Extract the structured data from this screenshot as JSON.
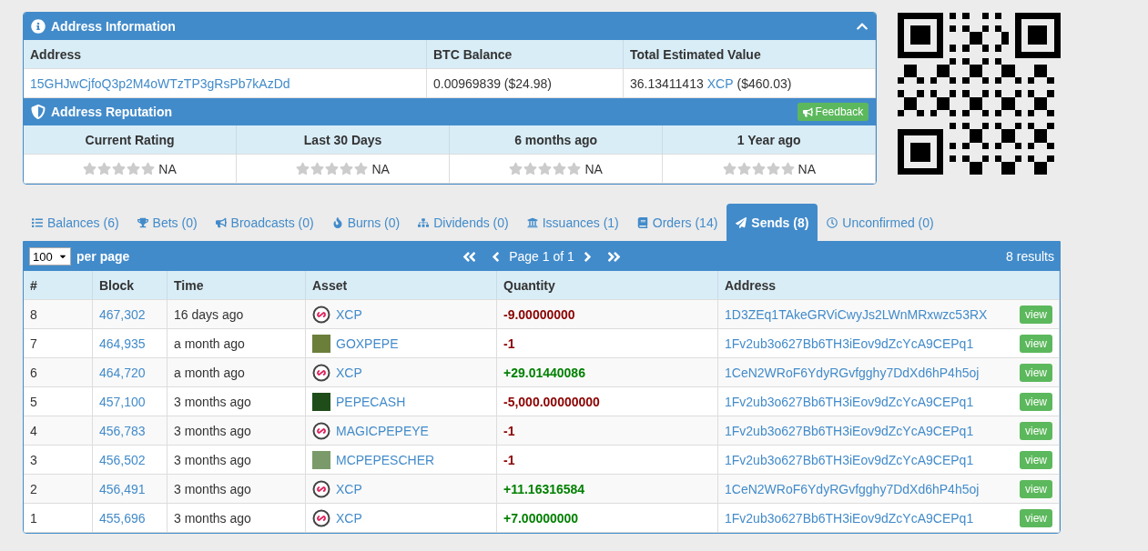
{
  "address_info": {
    "title": "Address Information",
    "collapsed": false,
    "columns": [
      "Address",
      "BTC Balance",
      "Total Estimated Value"
    ],
    "address": "15GHJwCjfoQ3p2M4oWTzTP3gRsPb7kAzDd",
    "btc_balance": "0.00969839 ($24.98)",
    "total_amount": "36.13411413",
    "total_asset": "XCP",
    "total_usd": "($460.03)"
  },
  "reputation": {
    "title": "Address Reputation",
    "feedback_button": "Feedback",
    "periods": [
      {
        "label": "Current Rating",
        "stars": 0,
        "value": "NA"
      },
      {
        "label": "Last 30 Days",
        "stars": 0,
        "value": "NA"
      },
      {
        "label": "6 months ago",
        "stars": 0,
        "value": "NA"
      },
      {
        "label": "1 Year ago",
        "stars": 0,
        "value": "NA"
      }
    ]
  },
  "tabs": [
    {
      "label": "Balances (6)",
      "selected": false
    },
    {
      "label": "Bets (0)",
      "selected": false
    },
    {
      "label": "Broadcasts (0)",
      "selected": false
    },
    {
      "label": "Burns (0)",
      "selected": false
    },
    {
      "label": "Dividends (0)",
      "selected": false
    },
    {
      "label": "Issuances (1)",
      "selected": false
    },
    {
      "label": "Orders (14)",
      "selected": false
    },
    {
      "label": "Sends (8)",
      "selected": true
    },
    {
      "label": "Unconfirmed (0)",
      "selected": false
    }
  ],
  "pager": {
    "per_page_value": "100",
    "per_page_label": "per page",
    "page_text": "Page 1 of 1",
    "results": "8 results"
  },
  "table": {
    "columns": [
      "#",
      "Block",
      "Time",
      "Asset",
      "Quantity",
      "Address"
    ],
    "rows": [
      {
        "index": "8",
        "block": "467,302",
        "time": "16 days ago",
        "asset": {
          "name": "XCP",
          "kind": "token"
        },
        "quantity": {
          "text": "-9.00000000",
          "kind": "out"
        },
        "address": "1D3ZEq1TAkeGRViCwyJs2LWnMRxwzc53RX",
        "view": "view"
      },
      {
        "index": "7",
        "block": "464,935",
        "time": "a month ago",
        "asset": {
          "name": "GOXPEPE",
          "kind": "image"
        },
        "quantity": {
          "text": "-1",
          "kind": "out"
        },
        "address": "1Fv2ub3o627Bb6TH3iEov9dZcYcA9CEPq1",
        "view": "view"
      },
      {
        "index": "6",
        "block": "464,720",
        "time": "a month ago",
        "asset": {
          "name": "XCP",
          "kind": "token"
        },
        "quantity": {
          "text": "+29.01440086",
          "kind": "in"
        },
        "address": "1CeN2WRoF6YdyRGvfgghy7DdXd6hP4h5oj",
        "view": "view"
      },
      {
        "index": "5",
        "block": "457,100",
        "time": "3 months ago",
        "asset": {
          "name": "PEPECASH",
          "kind": "image"
        },
        "quantity": {
          "text": "-5,000.00000000",
          "kind": "out"
        },
        "address": "1Fv2ub3o627Bb6TH3iEov9dZcYcA9CEPq1",
        "view": "view"
      },
      {
        "index": "4",
        "block": "456,783",
        "time": "3 months ago",
        "asset": {
          "name": "MAGICPEPEYE",
          "kind": "token"
        },
        "quantity": {
          "text": "-1",
          "kind": "out"
        },
        "address": "1Fv2ub3o627Bb6TH3iEov9dZcYcA9CEPq1",
        "view": "view"
      },
      {
        "index": "3",
        "block": "456,502",
        "time": "3 months ago",
        "asset": {
          "name": "MCPEPESCHER",
          "kind": "image"
        },
        "quantity": {
          "text": "-1",
          "kind": "out"
        },
        "address": "1Fv2ub3o627Bb6TH3iEov9dZcYcA9CEPq1",
        "view": "view"
      },
      {
        "index": "2",
        "block": "456,491",
        "time": "3 months ago",
        "asset": {
          "name": "XCP",
          "kind": "token"
        },
        "quantity": {
          "text": "+11.16316584",
          "kind": "in"
        },
        "address": "1CeN2WRoF6YdyRGvfgghy7DdXd6hP4h5oj",
        "view": "view"
      },
      {
        "index": "1",
        "block": "455,696",
        "time": "3 months ago",
        "asset": {
          "name": "XCP",
          "kind": "token"
        },
        "quantity": {
          "text": "+7.00000000",
          "kind": "in"
        },
        "address": "1Fv2ub3o627Bb6TH3iEov9dZcYcA9CEPq1",
        "view": "view"
      }
    ]
  }
}
